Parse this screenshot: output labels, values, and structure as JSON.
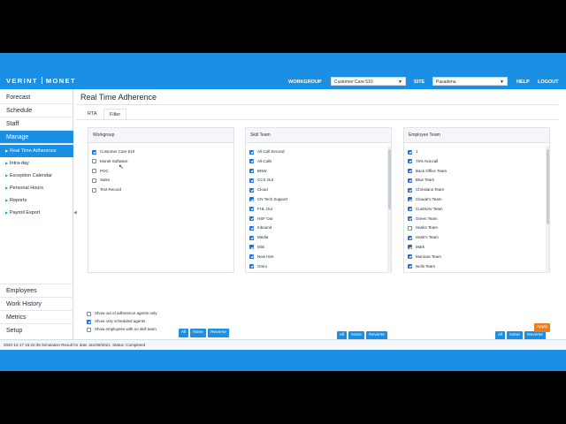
{
  "header": {
    "brand_left": "VERINT",
    "brand_right": "MONET",
    "workgroup_label": "WORKGROUP",
    "workgroup_value": "Customer Care 510",
    "site_label": "SITE",
    "site_value": "Pasadena",
    "help": "HELP",
    "logout": "LOGOUT"
  },
  "sidebar": {
    "main_items": [
      "Forecast",
      "Schedule",
      "Staff",
      "Manage"
    ],
    "sub_items": [
      "Real Time Adherence",
      "Intra-day",
      "Exception Calendar",
      "Personal Hours",
      "Reports",
      "Payroll Export"
    ],
    "bottom_items": [
      "Employees",
      "Work History",
      "Metrics",
      "Setup"
    ]
  },
  "page": {
    "title": "Real Time Adherence",
    "tabs": [
      "RTA",
      "Filter"
    ]
  },
  "panels": {
    "workgroup": {
      "header": "Workgroup",
      "items": [
        {
          "label": "Customer Care 510",
          "checked": true
        },
        {
          "label": "Monet Software",
          "checked": false
        },
        {
          "label": "POC",
          "checked": false
        },
        {
          "label": "Sales",
          "checked": false
        },
        {
          "label": "Test Record",
          "checked": false
        }
      ]
    },
    "skill_team": {
      "header": "Skill Team",
      "items": [
        {
          "label": "All Call Second",
          "checked": true
        },
        {
          "label": "All Calls",
          "checked": true
        },
        {
          "label": "BNW",
          "checked": true
        },
        {
          "label": "CCS Out",
          "checked": true
        },
        {
          "label": "Cloud",
          "checked": true
        },
        {
          "label": "CN Tech Support",
          "checked": true
        },
        {
          "label": "FHL Out",
          "checked": true
        },
        {
          "label": "HSF Out",
          "checked": true
        },
        {
          "label": "Inbound",
          "checked": true
        },
        {
          "label": "Media",
          "checked": true
        },
        {
          "label": "Mini",
          "checked": true
        },
        {
          "label": "New Hire",
          "checked": true
        },
        {
          "label": "Omni",
          "checked": true
        }
      ]
    },
    "employee_team": {
      "header": "Employee Team",
      "items": [
        {
          "label": "1",
          "checked": true
        },
        {
          "label": "75% Noncall",
          "checked": true
        },
        {
          "label": "Back Office Team",
          "checked": true
        },
        {
          "label": "Blue Team",
          "checked": true
        },
        {
          "label": "Christians Team",
          "checked": true
        },
        {
          "label": "Claude's Team",
          "checked": true
        },
        {
          "label": "CustServ Team",
          "checked": true
        },
        {
          "label": "Green Team",
          "checked": true
        },
        {
          "label": "Hanks Team",
          "checked": false
        },
        {
          "label": "Hank's Team",
          "checked": true
        },
        {
          "label": "Mark",
          "checked": true
        },
        {
          "label": "Monicas Team",
          "checked": true
        },
        {
          "label": "Neils Team",
          "checked": true
        }
      ]
    },
    "buttons": {
      "all": "All",
      "none": "None",
      "reverse": "Reverse"
    }
  },
  "options": [
    {
      "label": "Show out of adherence agents only",
      "checked": false
    },
    {
      "label": "Show only scheduled agents",
      "checked": true
    },
    {
      "label": "Show employees with no skill team",
      "checked": false
    }
  ],
  "apply_label": "Apply",
  "status_text": "2020-12-17 15:22:35 Simulation Result for date Jan/28/2021. Status :Completed",
  "colors": {
    "accent": "#1a8fe3",
    "checkbox": "#1f6fd1",
    "apply": "#ee7b1e"
  }
}
